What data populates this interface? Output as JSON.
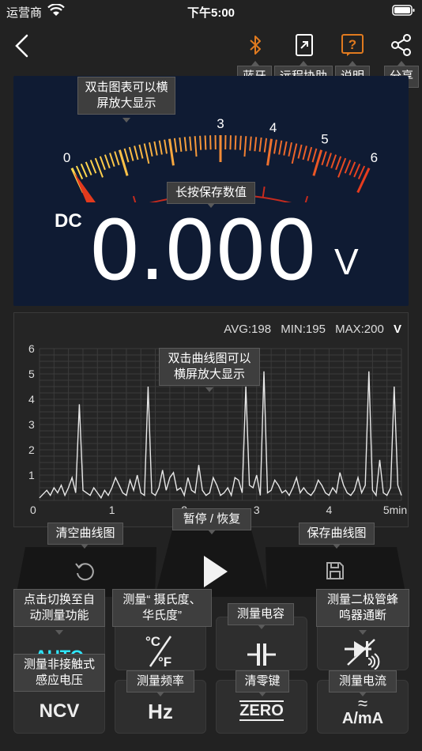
{
  "status": {
    "carrier": "运营商",
    "time": "下午5:00"
  },
  "top_bar": {
    "bluetooth_tip": "蓝牙",
    "remote_tip": "远程协助",
    "help_tip": "说明",
    "share_tip": "分享"
  },
  "gauge": {
    "tip_chart": "双击图表可以横屏放大显示",
    "tip_hold": "长按保存数值",
    "scale_labels": [
      "0",
      "3",
      "4",
      "5",
      "6"
    ],
    "mode": "DC",
    "reading": "0.000",
    "unit": "V",
    "needle_value": 0,
    "scale_max": 6
  },
  "chart": {
    "tip": "双击曲线图可以横屏放大显示",
    "avg": "AVG:198",
    "min": "MIN:195",
    "max": "MAX:200",
    "unit": "V"
  },
  "chart_data": {
    "type": "line",
    "x_ticks": [
      "0",
      "1",
      "2",
      "3",
      "4",
      "5min"
    ],
    "y_ticks": [
      "1",
      "2",
      "3",
      "4",
      "5",
      "6"
    ],
    "xlim": [
      0,
      5
    ],
    "ylim": [
      0,
      6
    ],
    "x": [
      0.0,
      0.1,
      0.15,
      0.2,
      0.25,
      0.3,
      0.35,
      0.4,
      0.45,
      0.5,
      0.55,
      0.6,
      0.65,
      0.7,
      0.75,
      0.8,
      0.85,
      0.9,
      0.95,
      1.0,
      1.05,
      1.1,
      1.15,
      1.2,
      1.25,
      1.3,
      1.35,
      1.4,
      1.45,
      1.5,
      1.55,
      1.6,
      1.65,
      1.7,
      1.75,
      1.8,
      1.85,
      1.9,
      1.95,
      2.0,
      2.05,
      2.1,
      2.15,
      2.2,
      2.25,
      2.3,
      2.35,
      2.4,
      2.45,
      2.5,
      2.55,
      2.6,
      2.65,
      2.7,
      2.75,
      2.8,
      2.85,
      2.9,
      2.95,
      3.0,
      3.05,
      3.1,
      3.15,
      3.2,
      3.25,
      3.3,
      3.35,
      3.4,
      3.45,
      3.5,
      3.55,
      3.6,
      3.65,
      3.7,
      3.75,
      3.8,
      3.85,
      3.9,
      3.95,
      4.0,
      4.05,
      4.1,
      4.15,
      4.2,
      4.25,
      4.3,
      4.35,
      4.4,
      4.45,
      4.5,
      4.55,
      4.6,
      4.65,
      4.7,
      4.75,
      4.8,
      4.85,
      4.9,
      4.95,
      5.0
    ],
    "y": [
      0.1,
      0.4,
      0.2,
      0.5,
      0.3,
      0.6,
      0.2,
      0.5,
      0.9,
      0.3,
      3.8,
      0.4,
      0.3,
      0.2,
      0.5,
      0.3,
      0.1,
      0.4,
      0.2,
      0.5,
      0.9,
      0.6,
      0.3,
      0.2,
      0.8,
      0.4,
      1.0,
      0.3,
      0.2,
      4.5,
      0.3,
      0.2,
      0.5,
      1.2,
      0.4,
      0.9,
      1.1,
      0.4,
      0.5,
      0.2,
      0.9,
      0.4,
      0.3,
      1.4,
      0.4,
      0.2,
      0.3,
      0.9,
      0.6,
      0.2,
      0.3,
      0.5,
      0.2,
      0.9,
      0.8,
      0.3,
      4.5,
      0.6,
      0.5,
      1.0,
      0.2,
      5.1,
      0.3,
      0.4,
      0.8,
      0.6,
      0.3,
      0.4,
      0.2,
      0.5,
      0.9,
      0.3,
      0.5,
      0.3,
      0.2,
      0.4,
      0.8,
      0.6,
      0.3,
      0.2,
      0.5,
      0.3,
      1.1,
      0.6,
      0.3,
      0.2,
      0.4,
      0.9,
      0.3,
      0.6,
      5.1,
      0.4,
      0.2,
      1.6,
      0.3,
      0.2,
      0.5,
      4.5,
      0.6,
      0.2
    ]
  },
  "controls": {
    "clear_tip": "清空曲线图",
    "pause_tip": "暂停 / 恢复",
    "save_tip": "保存曲线图",
    "auto_tip": "点击切换至自动测量功能",
    "temp_tip": "测量“ 摄氏度、华氏度”",
    "cap_tip": "测量电容",
    "diode_tip": "测量二极管蜂鸣器通断",
    "ncv_tip": "测量非接触式感应电压",
    "hz_tip": "测量频率",
    "zero_tip": "清零键",
    "current_tip": "测量电流",
    "auto_label": "AUTO",
    "ncv_label": "NCV",
    "hz_label": "Hz",
    "zero_label": "ZERO",
    "temp_c": "°C",
    "temp_f": "°F",
    "current_label": "A/mA",
    "current_symbol": "≈"
  },
  "colors": {
    "accent_orange": "#e07a1f",
    "auto_cyan": "#2ee6ff",
    "gauge_bg": "#0f1b33"
  }
}
